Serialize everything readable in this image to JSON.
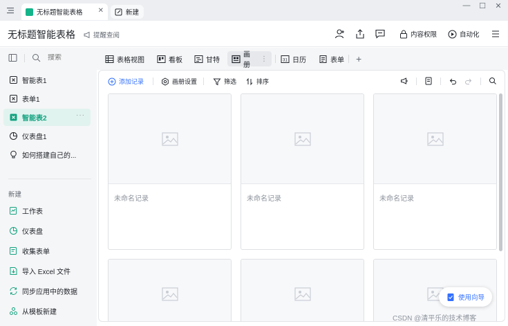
{
  "browser": {
    "tabs": [
      {
        "label": "无标题智能表格",
        "icon": "sheet-app-icon",
        "color": "#14b48a"
      },
      {
        "label": "新建",
        "icon": "new-doc-icon"
      }
    ],
    "window_controls": [
      "minimize",
      "maximize",
      "close"
    ]
  },
  "header": {
    "title": "无标题智能表格",
    "remind_label": "提醒查阅",
    "content_permission": "内容权限",
    "automation": "自动化"
  },
  "sidebar": {
    "search_placeholder": "搜索",
    "items": [
      {
        "label": "智能表1",
        "icon": "smart-sheet-icon"
      },
      {
        "label": "表单1",
        "icon": "smart-sheet-icon"
      },
      {
        "label": "智能表2",
        "icon": "smart-sheet-icon",
        "active": true
      },
      {
        "label": "仪表盘1",
        "icon": "dashboard-icon"
      },
      {
        "label": "如何搭建自己的...",
        "icon": "lightbulb-icon"
      }
    ],
    "new_section_label": "新建",
    "new_items": [
      {
        "label": "工作表",
        "icon": "worksheet-add-icon"
      },
      {
        "label": "仪表盘",
        "icon": "dashboard-add-icon"
      },
      {
        "label": "收集表单",
        "icon": "form-add-icon"
      },
      {
        "label": "导入 Excel 文件",
        "icon": "import-icon"
      },
      {
        "label": "同步应用中的数据",
        "icon": "sync-icon"
      },
      {
        "label": "从模板新建",
        "icon": "template-icon"
      }
    ],
    "more_label": "···"
  },
  "views": {
    "tabs": [
      {
        "label": "表格视图",
        "icon": "grid-view-icon"
      },
      {
        "label": "看板",
        "icon": "kanban-icon"
      },
      {
        "label": "甘特",
        "icon": "gantt-icon"
      },
      {
        "label": "画册",
        "icon": "gallery-icon",
        "active": true
      },
      {
        "label": "日历",
        "icon": "calendar-icon",
        "day": "31"
      },
      {
        "label": "表单",
        "icon": "form-icon"
      }
    ],
    "tab_more": "⋮",
    "add_view": "+"
  },
  "toolbar": {
    "add_record": "添加记录",
    "gallery_settings": "画册设置",
    "filter": "筛选",
    "sort": "排序"
  },
  "cards": [
    {
      "title": "未命名记录"
    },
    {
      "title": "未命名记录"
    },
    {
      "title": "未命名记录"
    },
    {
      "title": ""
    },
    {
      "title": ""
    },
    {
      "title": ""
    }
  ],
  "guide_label": "使用向导",
  "watermark": "CSDN @清平乐的技术博客",
  "colors": {
    "accent": "#12a37f",
    "link": "#3370ff",
    "sidebar_bg": "#f5f6f7"
  }
}
